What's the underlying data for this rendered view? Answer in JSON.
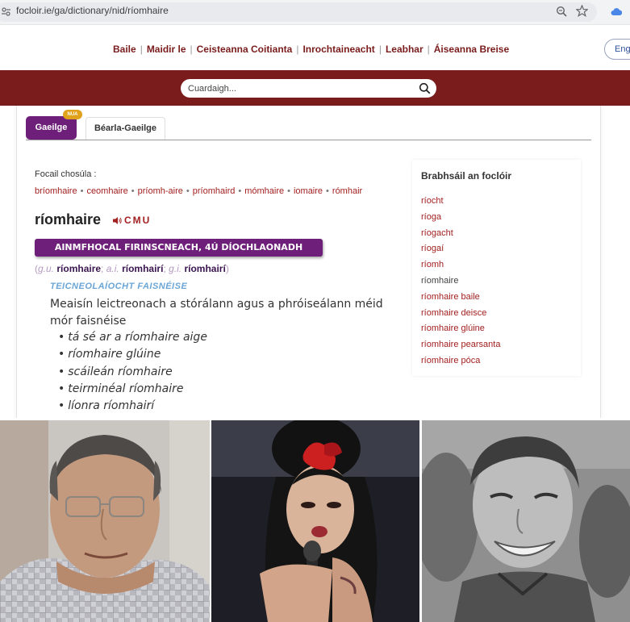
{
  "browser": {
    "url": "focloir.ie/ga/dictionary/nid/ríomhaire",
    "icons": [
      "site-settings-icon",
      "zoom-icon",
      "star-icon",
      "cloud-icon"
    ]
  },
  "nav": {
    "links": [
      "Baile",
      "Maidir le",
      "Ceisteanna Coitianta",
      "Inrochtaineacht",
      "Leabhar",
      "Áiseanna Breise"
    ],
    "language_button": "Engl"
  },
  "search": {
    "placeholder": "Cuardaigh..."
  },
  "tabs": {
    "gaeilge": "Gaeilge",
    "new_badge": "NUA",
    "bearla": "Béarla-Gaeilge"
  },
  "entry": {
    "similar_label": "Focail chosúla :",
    "similar_words": [
      "bríomhaire",
      "ceomhaire",
      "príomh-aire",
      "príomhaird",
      "mómhaire",
      "iomaire",
      "rómhair"
    ],
    "headword": "ríomhaire",
    "dialect": "CMU",
    "part_of_speech": "AINMFHOCAL FIRINSCNEACH, 4Ú DÍOCHLAONADH",
    "forms": {
      "genitive_label": "g.u.",
      "genitive": "ríomhaire",
      "nom_plural_label": "a.i.",
      "nom_plural": "ríomhairí",
      "gen_plural_label": "g.i.",
      "gen_plural": "ríomhairí"
    },
    "domain": "TEICNEOLAÍOCHT FAISNÉISE",
    "definition": "Meaisín leictreonach a stórálann agus a phróiseálann méid mór faisnéise",
    "examples": [
      "tá sé ar a ríomhaire aige",
      "ríomhaire glúine",
      "scáileán ríomhaire",
      "teirminéal ríomhaire",
      "líonra ríomhairí"
    ]
  },
  "browse": {
    "title": "Brabhsáil an foclóir",
    "items": [
      "ríocht",
      "ríoga",
      "ríogacht",
      "ríogaí",
      "ríomh",
      "ríomhaire",
      "ríomhaire baile",
      "ríomhaire deisce",
      "ríomhaire glúine",
      "ríomhaire pearsanta",
      "ríomhaire póca"
    ],
    "current": "ríomhaire"
  },
  "colors": {
    "brand_red": "#7b1c1c",
    "link_red": "#a32020",
    "purple": "#6e1f7a",
    "badge_orange": "#e0a21a",
    "domain_blue": "#6aa5d5"
  }
}
